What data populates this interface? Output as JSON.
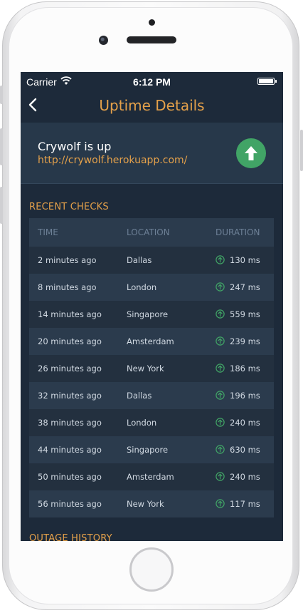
{
  "status_bar": {
    "carrier": "Carrier",
    "time": "6:12 PM"
  },
  "navbar": {
    "title": "Uptime Details"
  },
  "site": {
    "status": "Crywolf is up",
    "url": "http://crywolf.herokuapp.com/"
  },
  "recent_checks": {
    "title": "RECENT CHECKS",
    "columns": [
      "TIME",
      "LOCATION",
      "DURATION"
    ],
    "rows": [
      {
        "time": "2 minutes ago",
        "location": "Dallas",
        "duration": "130 ms"
      },
      {
        "time": "8 minutes ago",
        "location": "London",
        "duration": "247 ms"
      },
      {
        "time": "14 minutes ago",
        "location": "Singapore",
        "duration": "559 ms"
      },
      {
        "time": "20 minutes ago",
        "location": "Amsterdam",
        "duration": "239 ms"
      },
      {
        "time": "26 minutes ago",
        "location": "New York",
        "duration": "186 ms"
      },
      {
        "time": "32 minutes ago",
        "location": "Dallas",
        "duration": "196 ms"
      },
      {
        "time": "38 minutes ago",
        "location": "London",
        "duration": "240 ms"
      },
      {
        "time": "44 minutes ago",
        "location": "Singapore",
        "duration": "630 ms"
      },
      {
        "time": "50 minutes ago",
        "location": "Amsterdam",
        "duration": "240 ms"
      },
      {
        "time": "56 minutes ago",
        "location": "New York",
        "duration": "117 ms"
      }
    ]
  },
  "outage_history": {
    "title": "OUTAGE HISTORY"
  },
  "icons": {
    "back": "chevron-left-icon",
    "up": "arrow-up-icon",
    "wifi": "wifi-icon",
    "battery": "battery-icon"
  },
  "colors": {
    "accent": "#e5a14a",
    "up_green": "#41a466",
    "background": "#1d2a3a"
  }
}
